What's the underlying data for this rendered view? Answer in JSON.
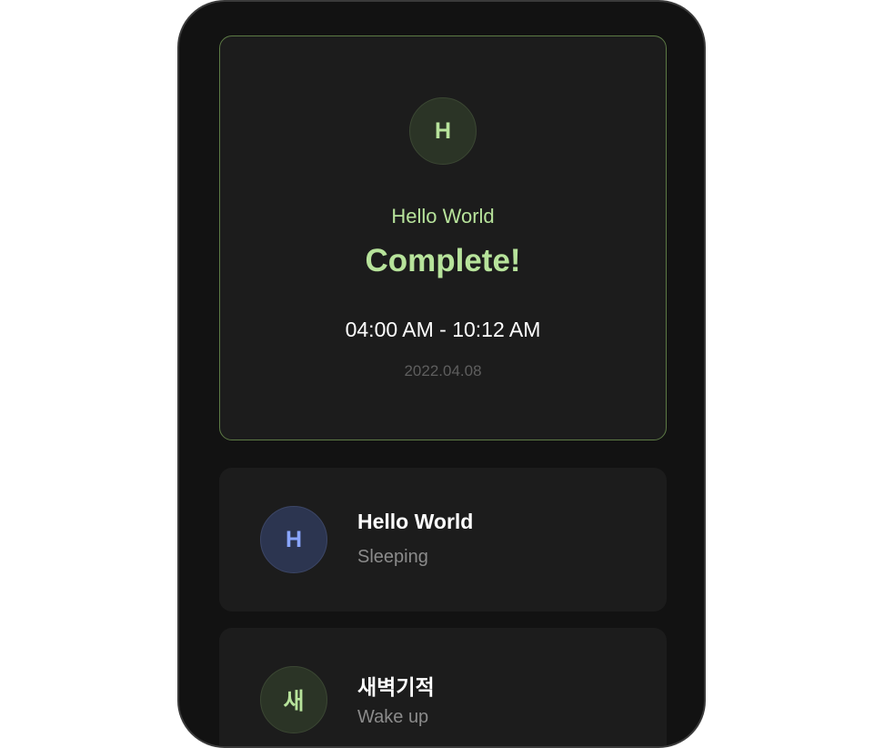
{
  "hero": {
    "avatar_initial": "H",
    "name": "Hello World",
    "status": "Complete!",
    "time_range": "04:00 AM - 10:12 AM",
    "date": "2022.04.08",
    "accent_color": "#b7e39b"
  },
  "list": [
    {
      "avatar_initial": "H",
      "title": "Hello World",
      "subtitle": "Sleeping",
      "accent_color": "#89a5ff"
    },
    {
      "avatar_initial": "새",
      "title": "새벽기적",
      "subtitle": "Wake up",
      "accent_color": "#b7e39b"
    }
  ]
}
